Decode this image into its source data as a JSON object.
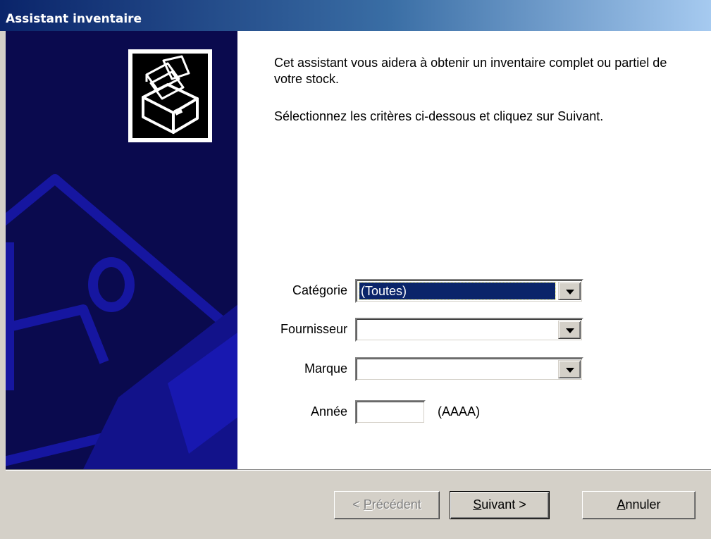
{
  "window": {
    "title": "Assistant inventaire"
  },
  "intro": {
    "line1": "Cet assistant vous aidera à obtenir un inventaire complet ou partiel de votre stock.",
    "line2": "Sélectionnez les critères ci-dessous et cliquez sur Suivant."
  },
  "form": {
    "categorie": {
      "label": "Catégorie",
      "value": "(Toutes)"
    },
    "fournisseur": {
      "label": "Fournisseur",
      "value": ""
    },
    "marque": {
      "label": "Marque",
      "value": ""
    },
    "annee": {
      "label": "Année",
      "value": "",
      "hint": "(AAAA)"
    }
  },
  "buttons": {
    "precedent": {
      "prefix": "< ",
      "accel": "P",
      "rest": "récédent"
    },
    "suivant": {
      "accel": "S",
      "rest": "uivant >"
    },
    "annuler": {
      "accel": "A",
      "rest": "nnuler"
    }
  },
  "colors": {
    "sidebar_bg": "#0a0a4e",
    "titlebar_start": "#0a246a",
    "titlebar_end": "#a6caf0",
    "selection": "#0a246a"
  },
  "icons": {
    "wizard_logo": "inventory-box-icon",
    "sidebar_watermark": "picture-watermark"
  }
}
